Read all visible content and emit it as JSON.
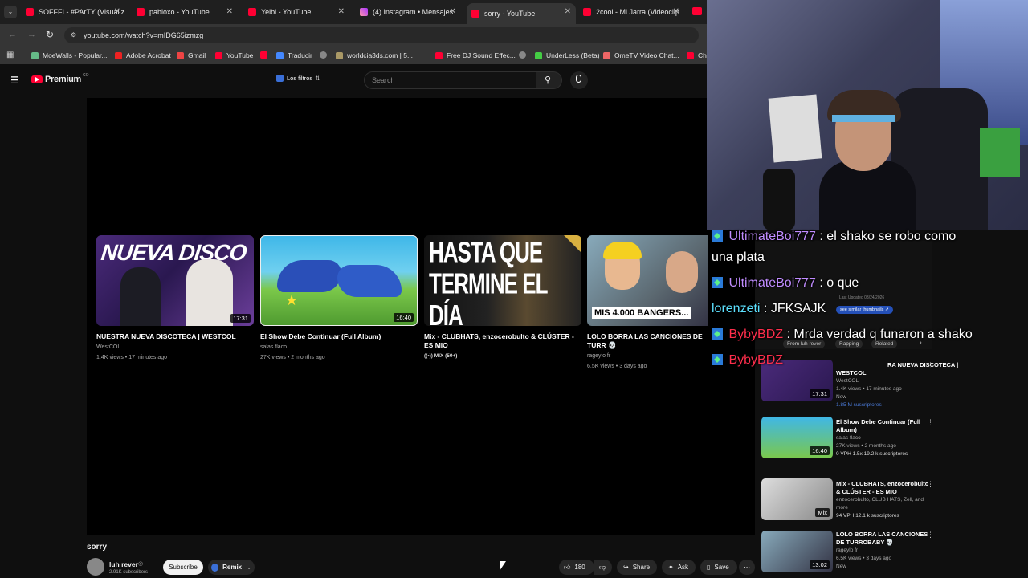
{
  "browser": {
    "tabs": [
      {
        "label": "SOFFFI - #PArTY (Visualiz",
        "icon": "youtube-icon"
      },
      {
        "label": "pabloxo - YouTube",
        "icon": "youtube-icon"
      },
      {
        "label": "Yeibi - YouTube",
        "icon": "youtube-icon"
      },
      {
        "label": "(4) Instagram • Mensajes",
        "icon": "instagram-icon"
      },
      {
        "label": "sorry - YouTube",
        "icon": "youtube-icon",
        "active": true
      },
      {
        "label": "2cool - Mi Jarra (Videoclip",
        "icon": "youtube-icon"
      }
    ],
    "url": "youtube.com/watch?v=mIDG65izmzg",
    "bookmarks": [
      "MoeWalls - Popular...",
      "Adobe Acrobat",
      "Gmail",
      "YouTube",
      "",
      "Traducir",
      "",
      "worldcia3ds.com | 5...",
      "Free DJ Sound Effec...",
      "",
      "UnderLess (Beta)",
      "OmeTV Video Chat...",
      "Ch"
    ]
  },
  "youtube": {
    "logo": "Premium",
    "logo_sup": "CO",
    "filter_label": "Los filtros",
    "search_placeholder": "Search"
  },
  "endscreen": [
    {
      "title": "NUESTRA NUEVA DISCOTECA | WESTCOL",
      "channel": "WestCOL",
      "meta": "1.4K views • 17 minutes ago",
      "duration": "17:31",
      "thumb_text": "NUEVA DISCO"
    },
    {
      "title": "El Show Debe Continuar (Full Album)",
      "channel": "salas flaco",
      "meta": "27K views • 2 months ago",
      "duration": "16:40",
      "thumb_text": ""
    },
    {
      "title": "Mix - CLUBHATS, enzocerobulto & CLÚSTER - ES MIO",
      "channel": "MIX (50+)",
      "meta": "",
      "duration": "",
      "thumb_text": "HASTA QUE TERMINE EL DÍA"
    },
    {
      "title": "LOLO BORRA LAS CANCIONES DE TURR 💀",
      "channel": "rageylo fr",
      "meta": "6.5K views • 3 days ago",
      "duration": "",
      "thumb_text": "MIS 4.000 BANGERS..."
    }
  ],
  "video": {
    "title": "sorry",
    "channel": "luh rever",
    "subs": "2.91K subscribers",
    "subscribe": "Subscribe",
    "remix": "Remix",
    "likes": "180",
    "share": "Share",
    "ask": "Ask",
    "save": "Save"
  },
  "sidebar": {
    "tabs": [
      "From luh rever",
      "Rapping",
      "Related"
    ],
    "items": [
      {
        "title": "RA NUEVA DISCOTECA |",
        "channel": "WESTCOL",
        "meta1": "WestCOL",
        "meta2": "1.4K views • 17 minutes ago",
        "meta3": "New",
        "meta4": "1.85 M suscriptores",
        "duration": "17:31"
      },
      {
        "title": "El Show Debe Continuar (Full Album)",
        "meta1": "salas flaco",
        "meta2": "27K views • 2 months ago",
        "meta3": "0 VPH    1.5x    19.2 k suscriptores",
        "duration": "16:40"
      },
      {
        "title": "Mix - CLUBHATS, enzocerobulto & CLÚSTER - ES MIO",
        "meta1": "enzocerobulto, CLUB HATS, Zell, and more",
        "meta2": "94 VPH    12.1 k suscriptores",
        "duration": "Mix"
      },
      {
        "title": "LOLO BORRA LAS CANCIONES DE TURROBABY 💀",
        "meta1": "rageylo fr",
        "meta2": "6.5K views • 3 days ago",
        "meta3": "New",
        "duration": "13:02"
      }
    ],
    "overlay_texts": [
      "Last Updated 03/24/2026",
      "see similar thumbnails ↗"
    ]
  },
  "chat": [
    {
      "user": "UltimateBoi777",
      "msg": " : el shako se robo como",
      "cont": "una plata",
      "color": "#c08cff"
    },
    {
      "user": "UltimateBoi777",
      "msg": " : o que",
      "color": "#c08cff"
    },
    {
      "user": "lorenzeti",
      "msg": " : JFKSAJK",
      "color": "#5ce1ff"
    },
    {
      "user": "BybyBDZ",
      "msg": " : Mrda verdad q funaron a shako",
      "color": "#ff2e4c"
    },
    {
      "user": "BybyBDZ",
      "msg": "",
      "color": "#ff2e4c"
    }
  ],
  "colors": {
    "yt_red": "#ff0033",
    "bg": "#0f0f0f",
    "chrome": "#353535"
  }
}
